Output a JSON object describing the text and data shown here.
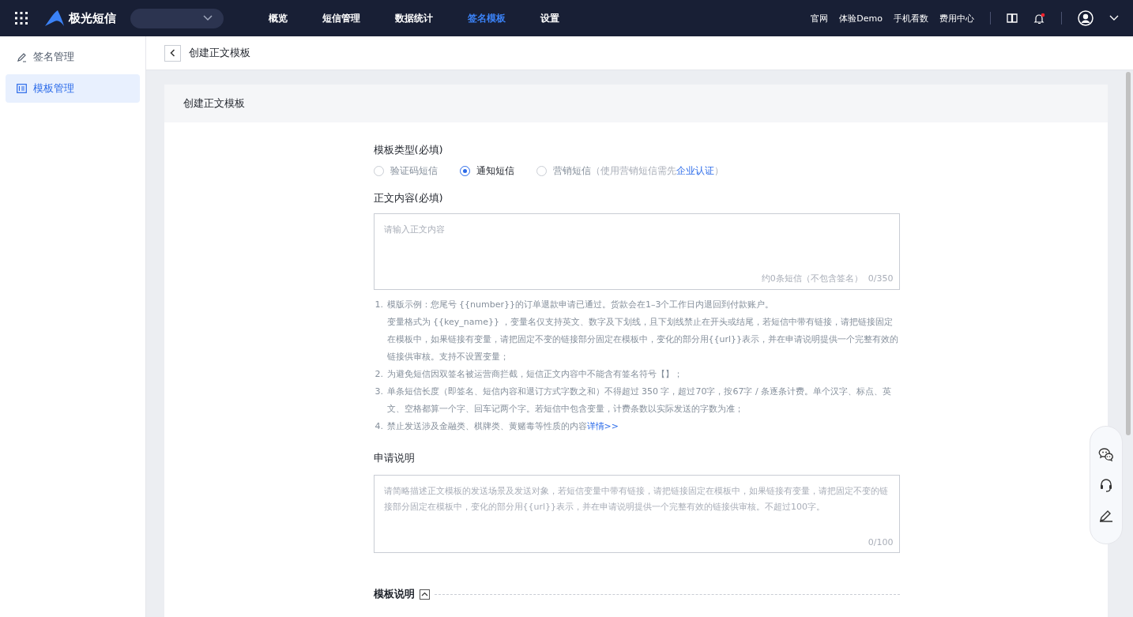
{
  "topbar": {
    "brand": "极光短信",
    "nav": [
      {
        "label": "概览",
        "selected": false
      },
      {
        "label": "短信管理",
        "selected": false
      },
      {
        "label": "数据统计",
        "selected": false
      },
      {
        "label": "签名模板",
        "selected": true
      },
      {
        "label": "设置",
        "selected": false
      }
    ],
    "links": [
      "官网",
      "体验Demo",
      "手机看数",
      "费用中心"
    ],
    "notification_unread": true
  },
  "sidebar": {
    "items": [
      {
        "label": "签名管理",
        "kind": "signature",
        "selected": false
      },
      {
        "label": "模板管理",
        "kind": "template",
        "selected": true
      }
    ]
  },
  "breadcrumb": {
    "title": "创建正文模板"
  },
  "card": {
    "title": "创建正文模板",
    "type_field": {
      "label": "模板类型(必填)",
      "options": [
        {
          "label": "验证码短信",
          "selected": false
        },
        {
          "label": "通知短信",
          "selected": true
        },
        {
          "label": "营销短信",
          "selected": false,
          "hint_before": "（使用营销短信需先",
          "hint_link": "企业认证",
          "hint_after": "）"
        }
      ]
    },
    "content_field": {
      "label": "正文内容(必填)",
      "placeholder": "请输入正文内容",
      "estimate": "约0条短信（不包含签名）",
      "counter": "0/350"
    },
    "notes": [
      {
        "number": "1.",
        "text": "模版示例：您尾号 {{number}}的订单退款申请已通过。货款会在1–3个工作日内退回到付款账户。",
        "extra": "变量格式为 {{key_name}} ，变量名仅支持英文、数字及下划线，且下划线禁止在开头或结尾，若短信中带有链接，请把链接固定在模板中，如果链接有变量，请把固定不变的链接部分固定在模板中，变化的部分用{{url}}表示，并在申请说明提供一个完整有效的链接供审核。支持不设置变量；"
      },
      {
        "number": "2.",
        "text": "为避免短信因双签名被运营商拦截，短信正文内容中不能含有签名符号【】；"
      },
      {
        "number": "3.",
        "text": "单条短信长度（即签名、短信内容和退订方式字数之和）不得超过 350 字，超过70字，按67字 / 条逐条计费。单个汉字、标点、英文、空格都算一个字、回车记两个字。若短信中包含变量，计费条数以实际发送的字数为准；"
      },
      {
        "number": "4.",
        "text": "禁止发送涉及金融类、棋牌类、黄赌毒等性质的内容",
        "link": "详情>>"
      }
    ],
    "description_field": {
      "label": "申请说明",
      "placeholder": "请简略描述正文模板的发送场景及发送对象，若短信变量中带有链接，请把链接固定在模板中，如果链接有变量，请把固定不变的链接部分固定在模板中，变化的部分用{{url}}表示，并在申请说明提供一个完整有效的链接供审核。不超过100字。",
      "counter": "0/100"
    },
    "section": {
      "title": "模板说明",
      "expanded": true
    }
  }
}
